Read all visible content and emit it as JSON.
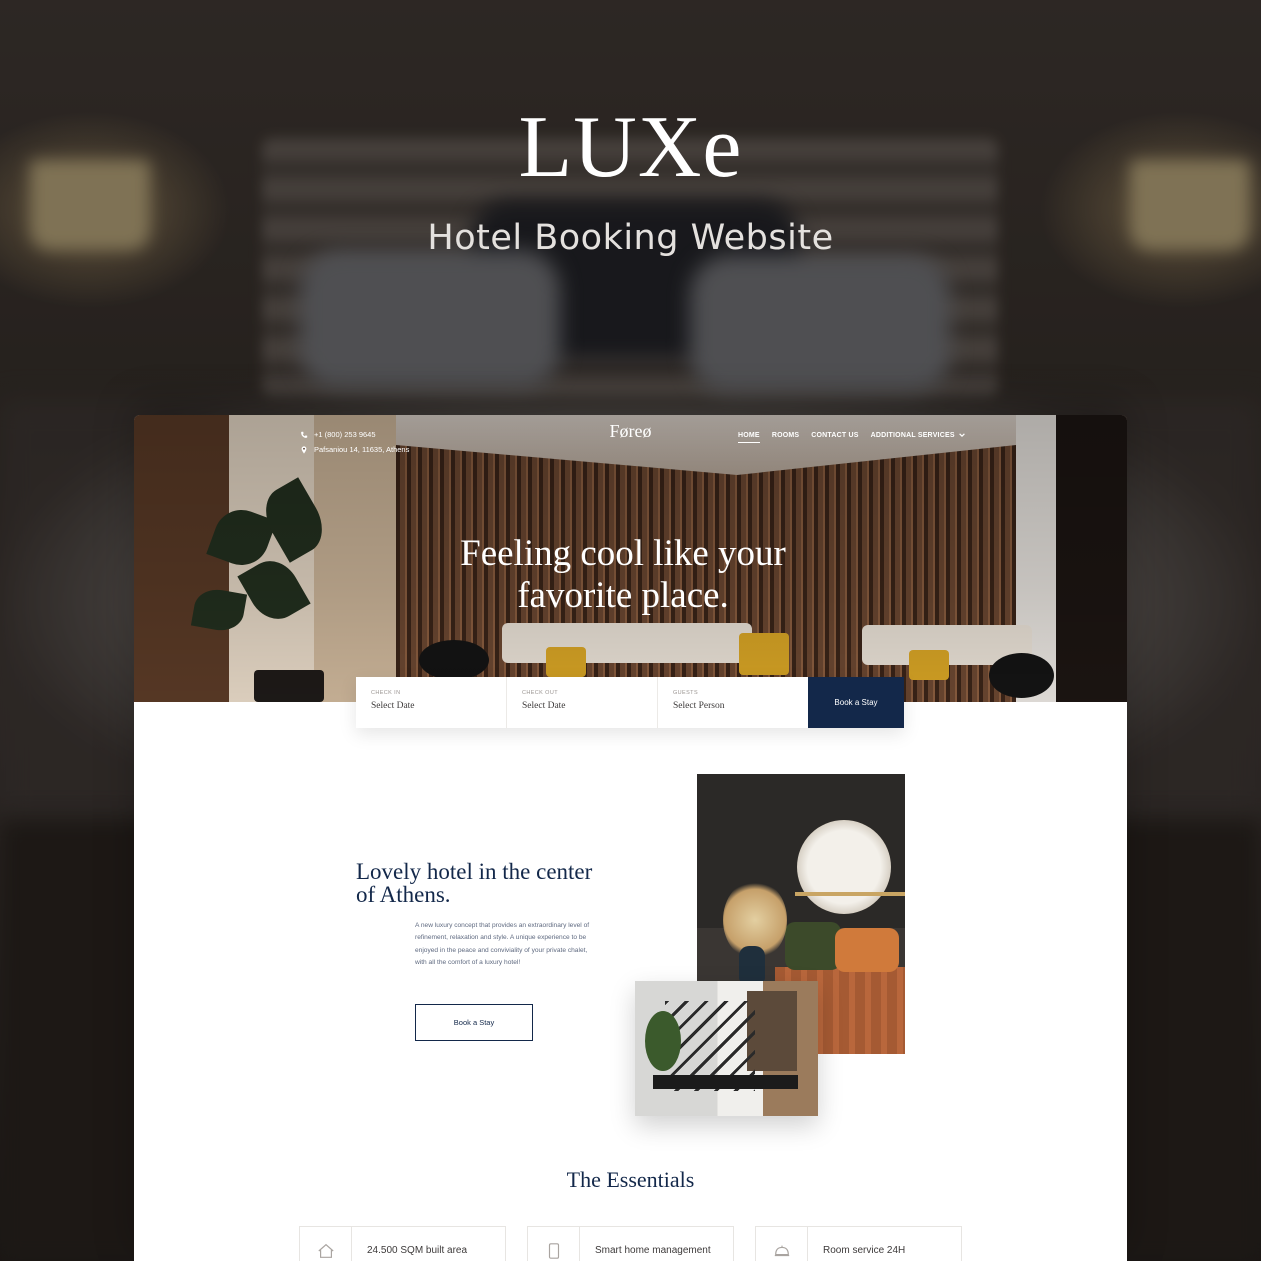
{
  "promo": {
    "title": "LUXe",
    "subtitle": "Hotel Booking Website"
  },
  "site": {
    "brand": "Føreø",
    "contact": {
      "phone": "+1 (800) 253 9645",
      "address": "Pafsaniou 14, 11635, Athens"
    },
    "nav": {
      "items": [
        "HOME",
        "ROOMS",
        "CONTACT US",
        "ADDITIONAL SERVICES"
      ],
      "active": "HOME"
    },
    "hero": {
      "headline_line1": "Feeling cool like your",
      "headline_line2": "favorite place."
    },
    "booking": {
      "check_in_label": "CHECK IN",
      "check_in_value": "Select Date",
      "check_out_label": "CHECK OUT",
      "check_out_value": "Select Date",
      "guests_label": "GUESTS",
      "guests_value": "Select Person",
      "button": "Book a Stay"
    },
    "about": {
      "title": "Lovely hotel in the center of Athens.",
      "body": "A new luxury concept that provides an extraordinary level of refinement, relaxation and style. A unique experience to be enjoyed in the peace and conviviality of your private chalet, with all the comfort of a luxury hotel!",
      "button": "Book a Stay"
    },
    "essentials": {
      "title": "The Essentials",
      "items": [
        {
          "label": "24.500 SQM built area",
          "icon": "home-icon"
        },
        {
          "label": "Smart home management",
          "icon": "phone-icon"
        },
        {
          "label": "Room service 24H",
          "icon": "cloche-icon"
        }
      ]
    }
  },
  "colors": {
    "navy": "#13284a",
    "body_text": "#5f6a80"
  }
}
